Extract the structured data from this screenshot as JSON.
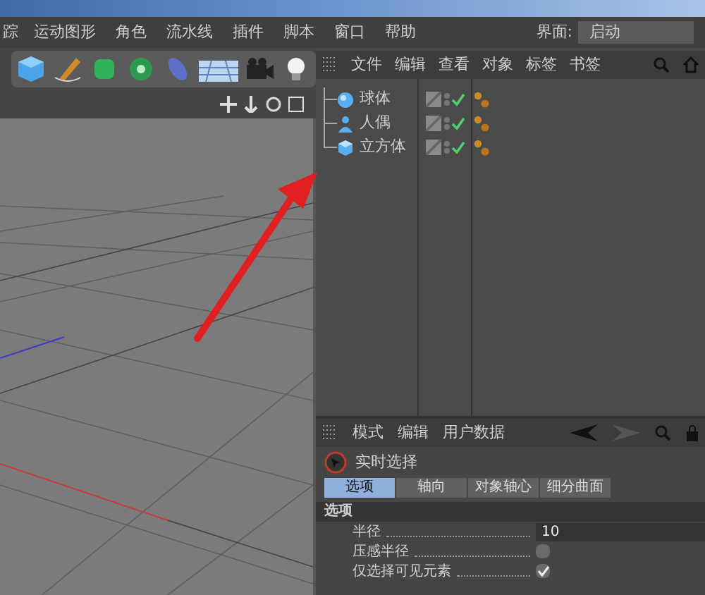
{
  "menu_bar": {
    "items": [
      "踪",
      "运动图形",
      "角色",
      "流水线",
      "插件",
      "脚本",
      "窗口",
      "帮助"
    ],
    "layout_label": "界面:",
    "layout_value": "启动"
  },
  "object_manager": {
    "menus": [
      "文件",
      "编辑",
      "查看",
      "对象",
      "标签",
      "书签"
    ],
    "objects": [
      {
        "name": "球体",
        "kind": "sphere",
        "enabled": true
      },
      {
        "name": "人偶",
        "kind": "figure",
        "enabled": true
      },
      {
        "name": "立方体",
        "kind": "cube",
        "enabled": true
      }
    ]
  },
  "attributes": {
    "menus": [
      "模式",
      "编辑",
      "用户数据"
    ],
    "tool_title": "实时选择",
    "tabs": [
      {
        "label": "选项",
        "selected": true
      },
      {
        "label": "轴向",
        "selected": false
      },
      {
        "label": "对象轴心",
        "selected": false
      },
      {
        "label": "细分曲面",
        "selected": false
      }
    ],
    "section": "选项",
    "fields": [
      {
        "kind": "number",
        "label": "半径",
        "value": "10"
      },
      {
        "kind": "checkbox",
        "label": "压感半径",
        "checked": false
      },
      {
        "kind": "checkbox",
        "label": "仅选择可见元素",
        "checked": true
      }
    ]
  }
}
